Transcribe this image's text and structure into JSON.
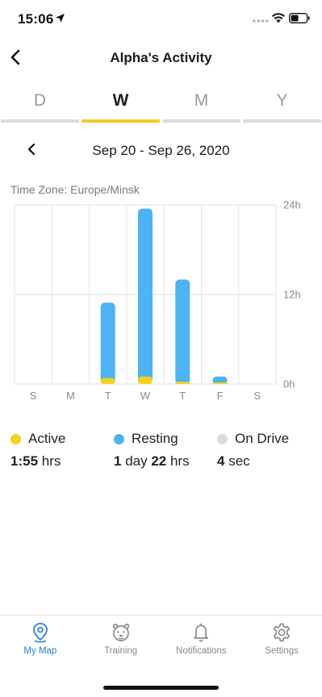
{
  "status_bar": {
    "time": "15:06"
  },
  "header": {
    "title": "Alpha's Activity"
  },
  "period_tabs": [
    {
      "label": "D",
      "active": false
    },
    {
      "label": "W",
      "active": true
    },
    {
      "label": "M",
      "active": false
    },
    {
      "label": "Y",
      "active": false
    }
  ],
  "date_range": {
    "label": "Sep 20 - Sep 26, 2020"
  },
  "timezone": {
    "label": "Time Zone: Europe/Minsk"
  },
  "chart_data": {
    "type": "bar",
    "stacked": true,
    "categories": [
      "S",
      "M",
      "T",
      "W",
      "T",
      "F",
      "S"
    ],
    "series": [
      {
        "name": "Active",
        "color": "#f5d21f",
        "values": [
          0,
          0,
          0.8,
          1.0,
          0.3,
          0.2,
          0
        ]
      },
      {
        "name": "Resting",
        "color": "#4db3f4",
        "values": [
          0,
          0,
          10.1,
          22.5,
          13.7,
          0.8,
          0
        ]
      }
    ],
    "y_ticks": [
      "0h",
      "12h",
      "24h"
    ],
    "ylim": [
      0,
      24
    ],
    "grid": true
  },
  "legend": [
    {
      "name": "Active",
      "color": "#f5d21f",
      "value_parts": [
        {
          "text": "1:55",
          "bold": true
        },
        {
          "text": " hrs",
          "bold": false
        }
      ]
    },
    {
      "name": "Resting",
      "color": "#4db3f4",
      "value_parts": [
        {
          "text": "1",
          "bold": true
        },
        {
          "text": " day ",
          "bold": false
        },
        {
          "text": "22",
          "bold": true
        },
        {
          "text": " hrs",
          "bold": false
        }
      ]
    },
    {
      "name": "On Drive",
      "color": "#d5dde3",
      "value_parts": [
        {
          "text": "4",
          "bold": true
        },
        {
          "text": " sec",
          "bold": false
        }
      ]
    }
  ],
  "tab_bar": [
    {
      "label": "My Map",
      "icon": "map-pin-icon",
      "active": true
    },
    {
      "label": "Training",
      "icon": "dog-face-icon",
      "active": false
    },
    {
      "label": "Notifications",
      "icon": "bell-icon",
      "active": false
    },
    {
      "label": "Settings",
      "icon": "gear-icon",
      "active": false
    }
  ],
  "colors": {
    "accent": "#f2cb2a",
    "tab_active": "#2d7fd6",
    "active_bar": "#f5d21f",
    "resting_bar": "#4db3f4"
  }
}
